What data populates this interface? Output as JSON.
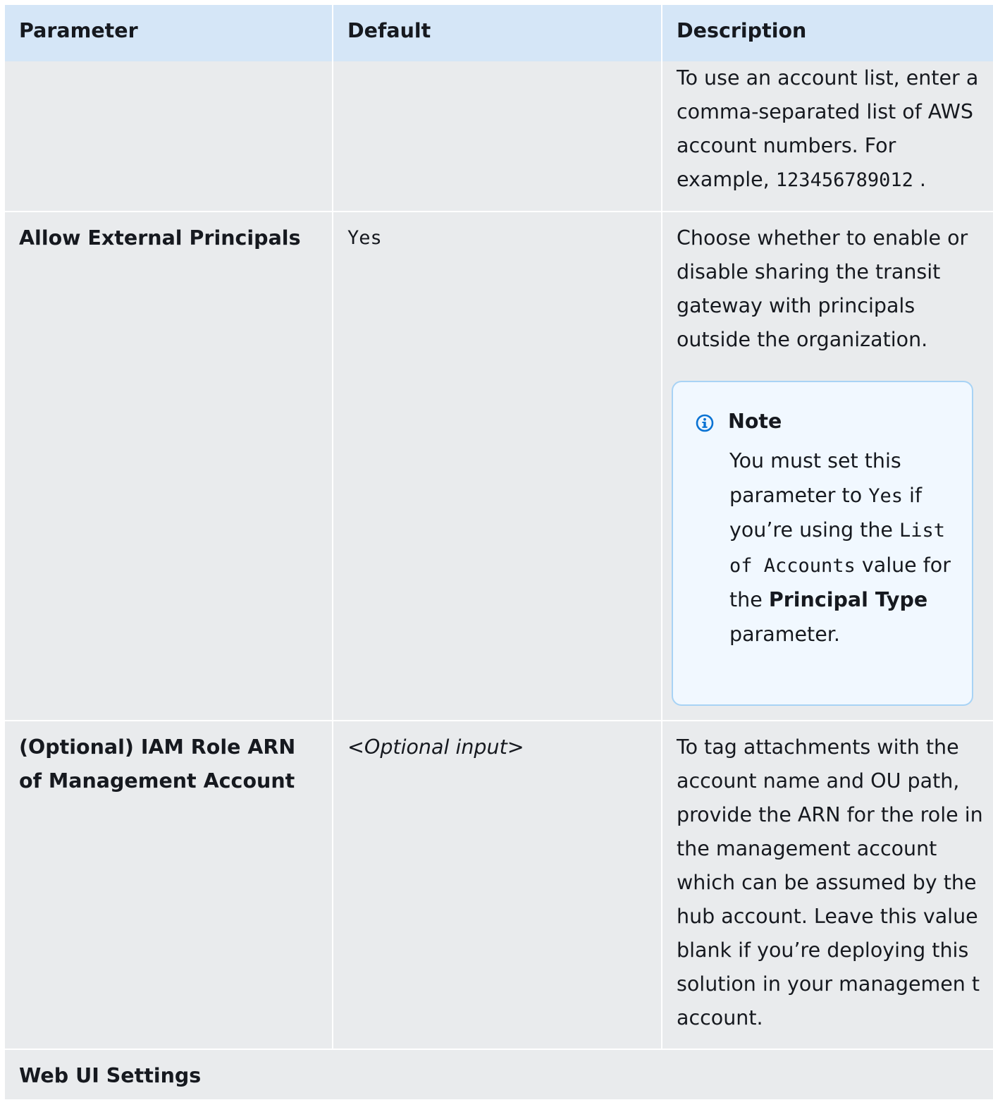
{
  "headers": {
    "parameter": "Parameter",
    "default": "Default",
    "description": "Description"
  },
  "row_account_list": {
    "description_text": "To use an account list, enter a comma-separated list of AWS account numbers. For example, ",
    "example_code": "123456789012",
    "trailing": " ."
  },
  "row_external_principals": {
    "parameter": "Allow External Principals",
    "default": "Yes",
    "description": "Choose whether to enable or disable sharing the transit gateway with principals outside the organization.",
    "note": {
      "icon": "info-icon",
      "title": "Note",
      "t1": "You must set this parameter to ",
      "c1": "Yes",
      "t2": " if you’re using the ",
      "c2": "List of Accounts",
      "t3": " value for the ",
      "b1": "Principal Type",
      "t4": " parameter."
    }
  },
  "row_iam_role": {
    "parameter": "(Optional) IAM Role ARN of Management Account",
    "default": "<Optional input>",
    "description": "To tag attachments with the account name and OU path, provide the ARN for the role in the management account which can be assumed by the hub account. Leave this value blank if you’re deploying this solution in your managemen t account."
  },
  "section_web_ui": {
    "title": "Web UI Settings"
  },
  "colors": {
    "header_bg": "#d5e6f7",
    "row_bg": "#e9ebed",
    "note_bg": "#f1f8ff",
    "note_border": "#a8d3f5",
    "info_icon": "#0972d3"
  }
}
